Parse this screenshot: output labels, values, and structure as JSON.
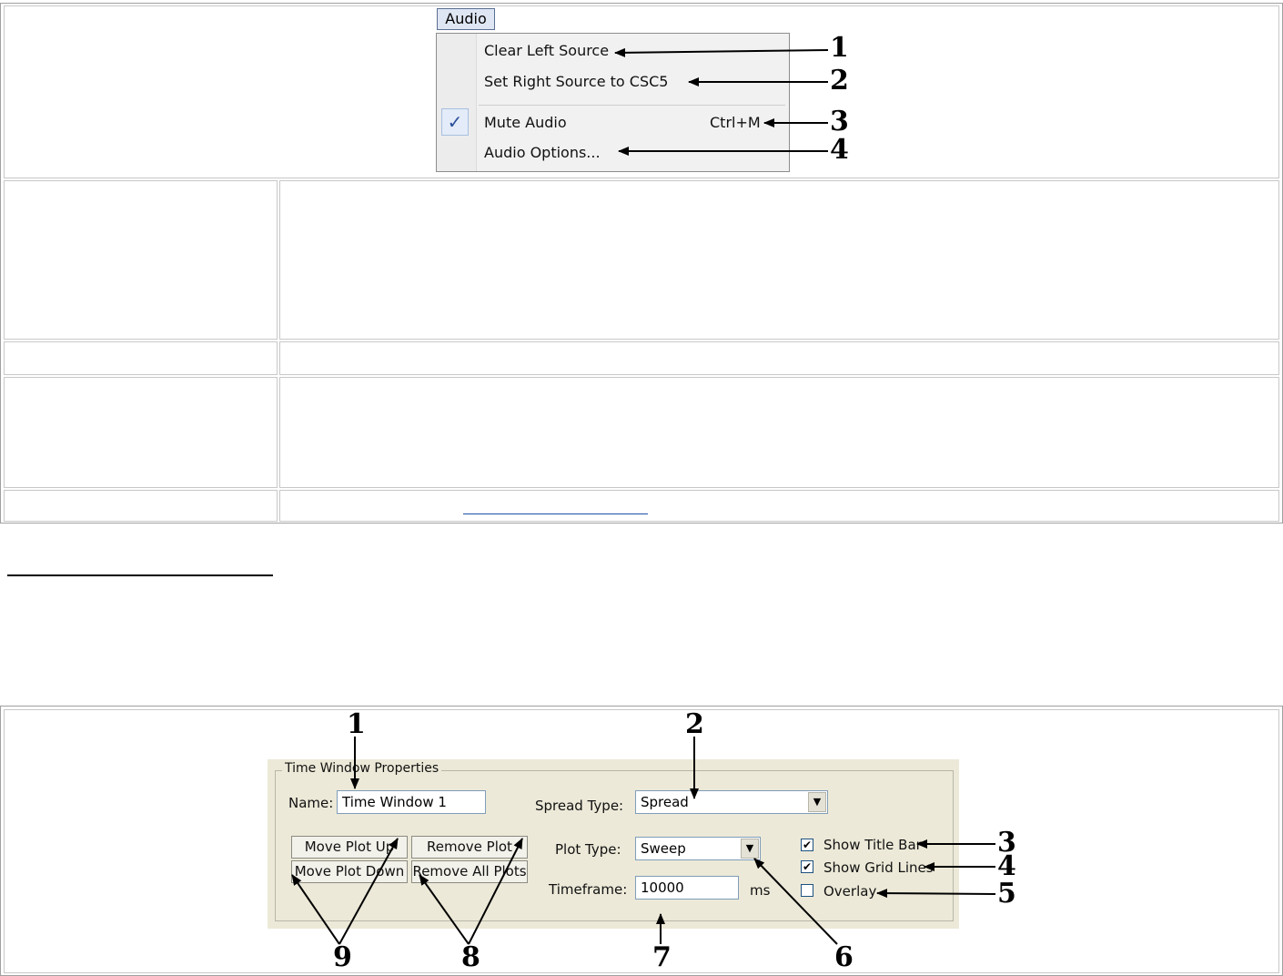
{
  "audio_menu": {
    "menubar_label": "Audio",
    "items": [
      {
        "label": "Clear Left Source",
        "shortcut": "",
        "checked": false
      },
      {
        "label": "Set Right Source to CSC5",
        "shortcut": "",
        "checked": false
      },
      {
        "label": "Mute Audio",
        "shortcut": "Ctrl+M",
        "checked": true
      },
      {
        "label": "Audio Options...",
        "shortcut": "",
        "checked": false
      }
    ],
    "check_glyph": "✓",
    "callouts": [
      "1",
      "2",
      "3",
      "4"
    ]
  },
  "time_window_properties": {
    "group_title": "Time Window Properties",
    "name_label": "Name:",
    "name_value": "Time Window 1",
    "spread_type_label": "Spread Type:",
    "spread_type_value": "Spread",
    "plot_type_label": "Plot Type:",
    "plot_type_value": "Sweep",
    "timeframe_label": "Timeframe:",
    "timeframe_value": "10000",
    "timeframe_unit": "ms",
    "buttons": {
      "move_up": "Move Plot Up",
      "move_down": "Move Plot Down",
      "remove": "Remove Plot",
      "remove_all": "Remove All Plots"
    },
    "checkboxes": [
      {
        "label": "Show Title Bar",
        "checked": true
      },
      {
        "label": "Show Grid Lines",
        "checked": true
      },
      {
        "label": "Overlay",
        "checked": false
      }
    ],
    "check_glyph": "✔",
    "dropdown_glyph": "▼",
    "callouts": [
      "1",
      "2",
      "3",
      "4",
      "5",
      "6",
      "7",
      "8",
      "9"
    ]
  }
}
